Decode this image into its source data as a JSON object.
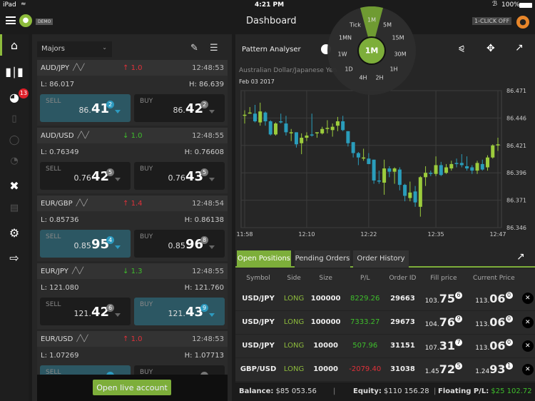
{
  "status": {
    "device": "iPad",
    "time": "4:21 PM",
    "battery": "100%"
  },
  "header": {
    "title": "Dashboard",
    "demo_badge": "DEMO",
    "one_click": "1-CLICK",
    "one_click_state": "OFF"
  },
  "sidebar": {
    "badge_count": "13",
    "items": [
      "home",
      "chart",
      "portfolio",
      "book",
      "timer",
      "gauge",
      "tools",
      "calendar",
      "settings",
      "logout"
    ]
  },
  "watchlist": {
    "dropdown": "Majors",
    "cards": [
      {
        "symbol": "AUD/JPY",
        "dir": "up",
        "change": "1.0",
        "time": "12:48:53",
        "low": "L: 86.017",
        "high": "H: 86.639",
        "sell": {
          "label": "SELL",
          "pre": "86.",
          "big": "41",
          "pip": "2",
          "active": true
        },
        "buy": {
          "label": "BUY",
          "pre": "86.",
          "big": "42",
          "pip": "2",
          "active": false
        }
      },
      {
        "symbol": "AUD/USD",
        "dir": "down",
        "change": "1.0",
        "time": "12:48:55",
        "low": "L: 0.76349",
        "high": "H: 0.76608",
        "sell": {
          "label": "SELL",
          "pre": "0.76",
          "big": "42",
          "pip": "5",
          "active": false
        },
        "buy": {
          "label": "BUY",
          "pre": "0.76",
          "big": "43",
          "pip": "5",
          "active": false
        }
      },
      {
        "symbol": "EUR/GBP",
        "dir": "up",
        "change": "1.4",
        "time": "12:48:54",
        "low": "L: 0.85736",
        "high": "H: 0.86138",
        "sell": {
          "label": "SELL",
          "pre": "0.85",
          "big": "95",
          "pip": "4",
          "active": true
        },
        "buy": {
          "label": "BUY",
          "pre": "0.85",
          "big": "96",
          "pip": "8",
          "active": false
        }
      },
      {
        "symbol": "EUR/JPY",
        "dir": "down",
        "change": "1.3",
        "time": "12:48:55",
        "low": "L: 121.080",
        "high": "H: 121.760",
        "sell": {
          "label": "SELL",
          "pre": "121.",
          "big": "42",
          "pip": "6",
          "active": false
        },
        "buy": {
          "label": "BUY",
          "pre": "121.",
          "big": "43",
          "pip": "9",
          "active": true
        }
      },
      {
        "symbol": "EUR/USD",
        "dir": "up",
        "change": "1.0",
        "time": "12:48:53",
        "low": "L: 1.07269",
        "high": "H: 1.07713",
        "sell": {
          "label": "SELL",
          "pre": "",
          "big": "",
          "pip": "",
          "active": true
        },
        "buy": {
          "label": "BUY",
          "pre": "",
          "big": "",
          "pip": "",
          "active": false
        }
      }
    ],
    "open_live": "Open live account"
  },
  "chart_panel": {
    "title": "Pattern Analyser",
    "instrument": "Australian Dollar/Japanese Yen",
    "date": "Feb 03 2017",
    "timeframes": [
      "Tick",
      "1M",
      "5M",
      "15M",
      "30M",
      "1H",
      "2H",
      "4H",
      "1D",
      "1W",
      "1MN"
    ],
    "selected_timeframe": "1M"
  },
  "chart_data": {
    "type": "candlestick",
    "x_ticks": [
      "11:58",
      "12:10",
      "12:22",
      "12:35",
      "12:47"
    ],
    "y_ticks": [
      "86.471",
      "86.446",
      "86.421",
      "86.396",
      "86.371",
      "86.346"
    ],
    "ylim": [
      86.346,
      86.471
    ],
    "xlim": [
      "11:58",
      "12:47"
    ],
    "grid": true,
    "colors": {
      "up": "#9ccc3c",
      "down": "#2a9dbb"
    },
    "candles_ohlc": [
      [
        86.448,
        86.453,
        86.441,
        86.449
      ],
      [
        86.45,
        86.456,
        86.45,
        86.451
      ],
      [
        86.45,
        86.458,
        86.442,
        86.443
      ],
      [
        86.442,
        86.46,
        86.439,
        86.452
      ],
      [
        86.451,
        86.452,
        86.439,
        86.443
      ],
      [
        86.443,
        86.444,
        86.43,
        86.431
      ],
      [
        86.431,
        86.442,
        86.43,
        86.441
      ],
      [
        86.443,
        86.45,
        86.441,
        86.442
      ],
      [
        86.441,
        86.448,
        86.43,
        86.433
      ],
      [
        86.432,
        86.436,
        86.425,
        86.433
      ],
      [
        86.433,
        86.433,
        86.419,
        86.422
      ],
      [
        86.423,
        86.432,
        86.413,
        86.428
      ],
      [
        86.428,
        86.433,
        86.425,
        86.43
      ],
      [
        86.431,
        86.45,
        86.429,
        86.43
      ],
      [
        86.432,
        86.433,
        86.428,
        86.433
      ],
      [
        86.432,
        86.438,
        86.431,
        86.436
      ],
      [
        86.436,
        86.444,
        86.432,
        86.437
      ],
      [
        86.435,
        86.441,
        86.429,
        86.438
      ],
      [
        86.439,
        86.447,
        86.434,
        86.443
      ],
      [
        86.443,
        86.448,
        86.434,
        86.435
      ],
      [
        86.434,
        86.434,
        86.42,
        86.423
      ],
      [
        86.424,
        86.424,
        86.41,
        86.414
      ],
      [
        86.414,
        86.415,
        86.403,
        86.41
      ],
      [
        86.409,
        86.418,
        86.407,
        86.41
      ],
      [
        86.409,
        86.414,
        86.404,
        86.404
      ],
      [
        86.408,
        86.408,
        86.386,
        86.389
      ],
      [
        86.389,
        86.398,
        86.386,
        86.388
      ],
      [
        86.387,
        86.408,
        86.376,
        86.4
      ],
      [
        86.4,
        86.402,
        86.392,
        86.397
      ],
      [
        86.397,
        86.401,
        86.386,
        86.4
      ],
      [
        86.399,
        86.401,
        86.38,
        86.385
      ],
      [
        86.385,
        86.386,
        86.37,
        86.375
      ],
      [
        86.373,
        86.388,
        86.37,
        86.378
      ],
      [
        86.379,
        86.384,
        86.365,
        86.369
      ],
      [
        86.365,
        86.393,
        86.356,
        86.392
      ],
      [
        86.392,
        86.402,
        86.384,
        86.396
      ],
      [
        86.396,
        86.398,
        86.393,
        86.395
      ],
      [
        86.395,
        86.411,
        86.393,
        86.403
      ],
      [
        86.403,
        86.406,
        86.393,
        86.394
      ],
      [
        86.396,
        86.404,
        86.395,
        86.401
      ],
      [
        86.4,
        86.407,
        86.398,
        86.404
      ],
      [
        86.405,
        86.409,
        86.401,
        86.404
      ],
      [
        86.405,
        86.413,
        86.401,
        86.403
      ],
      [
        86.402,
        86.411,
        86.398,
        86.4
      ],
      [
        86.401,
        86.403,
        86.395,
        86.398
      ],
      [
        86.398,
        86.407,
        86.395,
        86.405
      ],
      [
        86.404,
        86.408,
        86.398,
        86.399
      ],
      [
        86.401,
        86.412,
        86.398,
        86.41
      ],
      [
        86.41,
        86.422,
        86.409,
        86.421
      ],
      [
        86.421,
        86.428,
        86.416,
        86.422
      ]
    ]
  },
  "positions": {
    "tabs": [
      "Open Positions",
      "Pending Orders",
      "Order History"
    ],
    "active_tab": 0,
    "columns": [
      "Symbol",
      "Side",
      "Size",
      "P/L",
      "Order ID",
      "Fill price",
      "Current Price"
    ],
    "rows": [
      {
        "symbol": "USD/JPY",
        "side": "LONG",
        "size": "100000",
        "pl": "8229.26",
        "pl_sign": "pos",
        "id": "29663",
        "fill_pre": "103.",
        "fill_big": "75",
        "fill_pip": "6",
        "cur_pre": "113.",
        "cur_big": "06",
        "cur_pip": "0"
      },
      {
        "symbol": "USD/JPY",
        "side": "LONG",
        "size": "100000",
        "pl": "7333.27",
        "pl_sign": "pos",
        "id": "29673",
        "fill_pre": "104.",
        "fill_big": "76",
        "fill_pip": "9",
        "cur_pre": "113.",
        "cur_big": "06",
        "cur_pip": "0"
      },
      {
        "symbol": "USD/JPY",
        "side": "LONG",
        "size": "10000",
        "pl": "507.96",
        "pl_sign": "pos",
        "id": "31151",
        "fill_pre": "107.",
        "fill_big": "31",
        "fill_pip": "7",
        "cur_pre": "113.",
        "cur_big": "06",
        "cur_pip": "0"
      },
      {
        "symbol": "GBP/USD",
        "side": "LONG",
        "size": "10000",
        "pl": "-2079.40",
        "pl_sign": "neg",
        "id": "31038",
        "fill_pre": "1.45",
        "fill_big": "72",
        "fill_pip": "5",
        "cur_pre": "1.24",
        "cur_big": "93",
        "cur_pip": "1"
      }
    ]
  },
  "footer": {
    "balance_label": "Balance:",
    "balance": "$85 053.56",
    "equity_label": "Equity:",
    "equity": "$110 156.28",
    "floating_label": "Floating P/L:",
    "floating": "$25 102.72"
  }
}
